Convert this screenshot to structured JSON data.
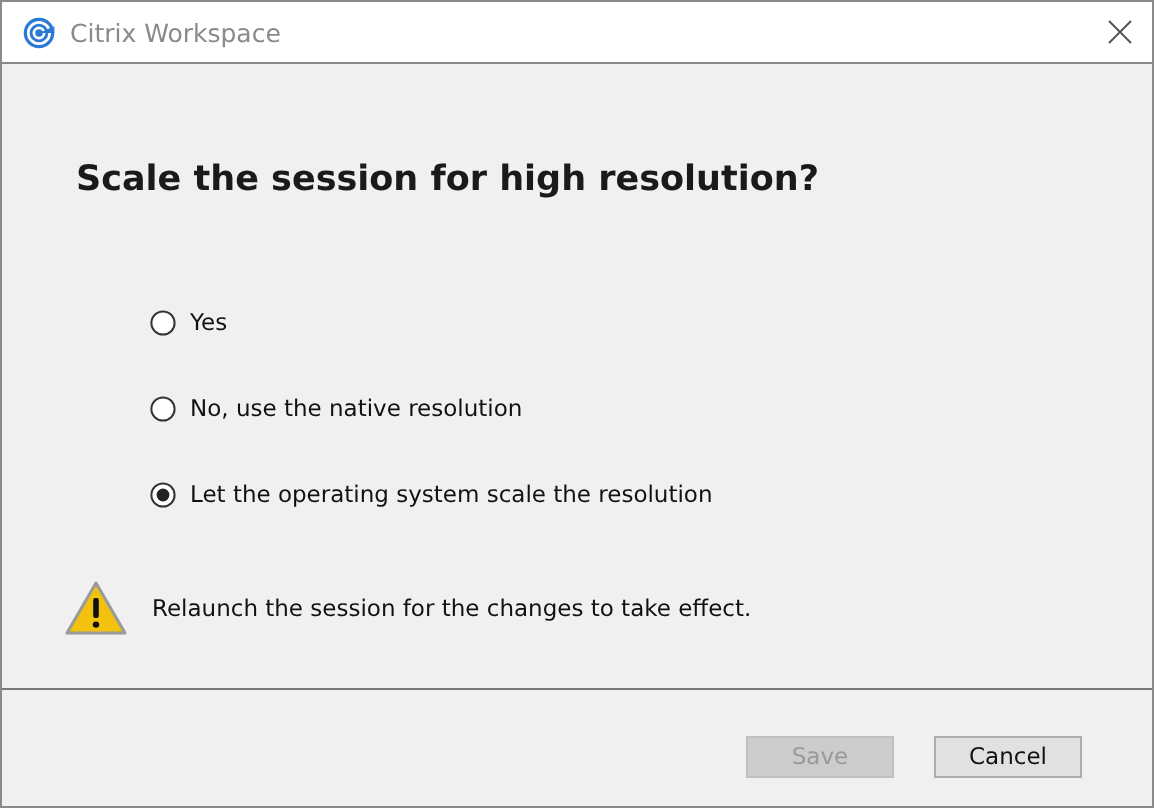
{
  "window": {
    "title": "Citrix Workspace"
  },
  "heading": "Scale the session for high resolution?",
  "options": [
    {
      "label": "Yes",
      "selected": false
    },
    {
      "label": "No, use the native resolution",
      "selected": false
    },
    {
      "label": "Let the operating system scale the resolution",
      "selected": true
    }
  ],
  "warning": "Relaunch the session for the changes to take effect.",
  "buttons": [
    {
      "label": "Save",
      "disabled": true
    },
    {
      "label": "Cancel",
      "disabled": false
    }
  ]
}
